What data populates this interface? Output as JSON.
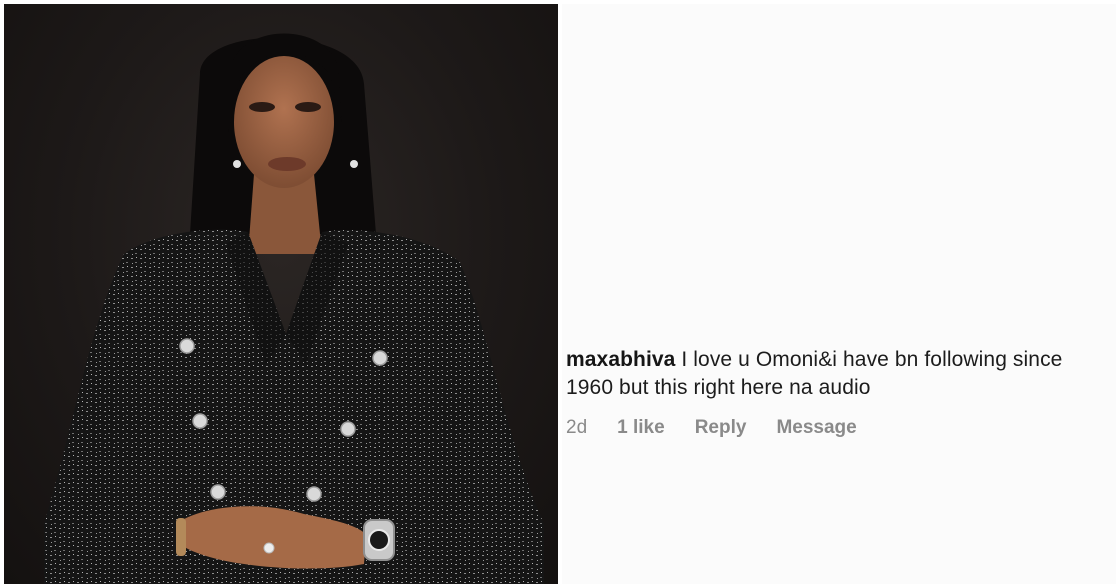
{
  "photo": {
    "subject": "portrait-woman-black-tweed-blazer"
  },
  "comment": {
    "username": "maxabhiva",
    "text": "I love u Omoni&i have bn following since 1960 but this right here na audio",
    "time": "2d",
    "likes": "1 like",
    "reply_label": "Reply",
    "message_label": "Message"
  },
  "colors": {
    "background_dark": "#1d1918",
    "blazer": "#141414",
    "skin": "#9b6443",
    "comment_bg": "#fbfbfb",
    "meta_text": "#8a8a8a"
  }
}
